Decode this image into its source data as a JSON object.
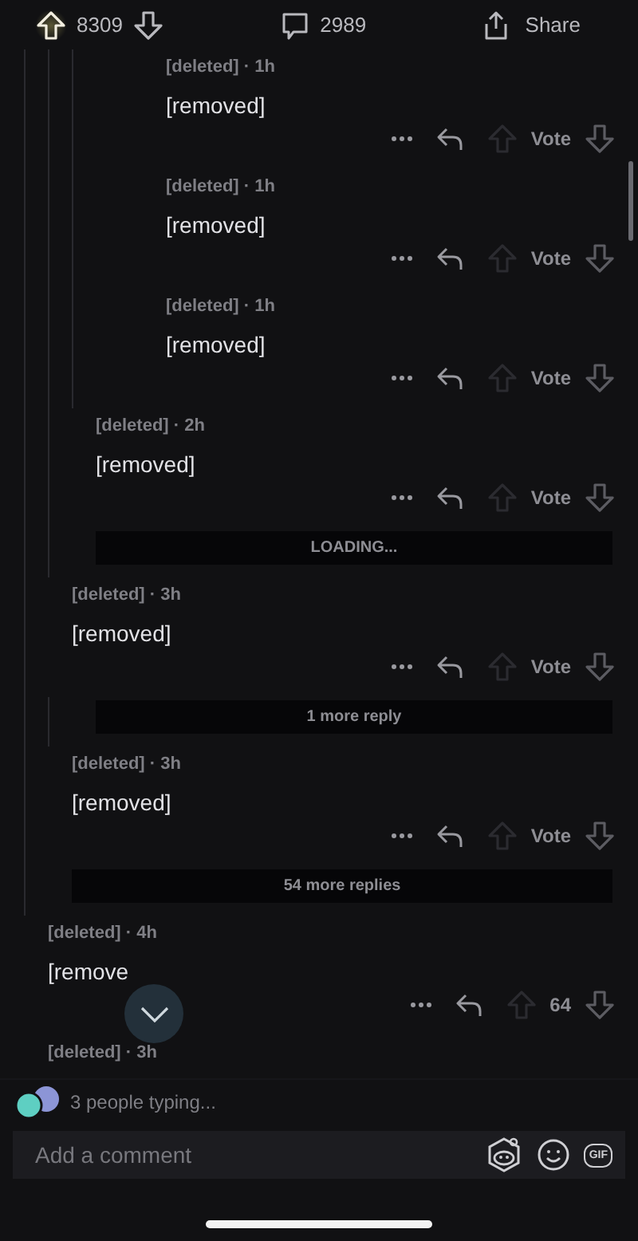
{
  "post_bar": {
    "upvoted": true,
    "score": "8309",
    "comments": "2989",
    "share": "Share"
  },
  "thread": [
    {
      "kind": "hidden",
      "children": [
        {
          "kind": "hidden",
          "children": [
            {
              "kind": "hidden",
              "children": [
                {
                  "kind": "comment",
                  "meta": "[deleted] · 1h",
                  "body": "[removed]",
                  "vote": "Vote"
                },
                {
                  "kind": "comment",
                  "meta": "[deleted] · 1h",
                  "body": "[removed]",
                  "vote": "Vote"
                },
                {
                  "kind": "comment",
                  "meta": "[deleted] · 1h",
                  "body": "[removed]",
                  "vote": "Vote"
                }
              ]
            },
            {
              "kind": "comment",
              "meta": "[deleted] · 2h",
              "body": "[removed]",
              "vote": "Vote"
            },
            {
              "kind": "more",
              "label": "LOADING..."
            }
          ]
        },
        {
          "kind": "comment",
          "meta": "[deleted] · 3h",
          "body": "[removed]",
          "vote": "Vote",
          "children": [
            {
              "kind": "more",
              "label": "1 more reply"
            }
          ]
        },
        {
          "kind": "comment",
          "meta": "[deleted] · 3h",
          "body": "[removed]",
          "vote": "Vote"
        },
        {
          "kind": "more",
          "label": "54 more replies"
        }
      ]
    },
    {
      "kind": "comment",
      "meta": "[deleted] · 4h",
      "body": "[remove",
      "vote": "64"
    },
    {
      "kind": "comment",
      "meta": "[deleted] · 3h"
    }
  ],
  "typing": "3 people typing...",
  "composer": {
    "placeholder": "Add a comment",
    "gif": "GIF"
  }
}
